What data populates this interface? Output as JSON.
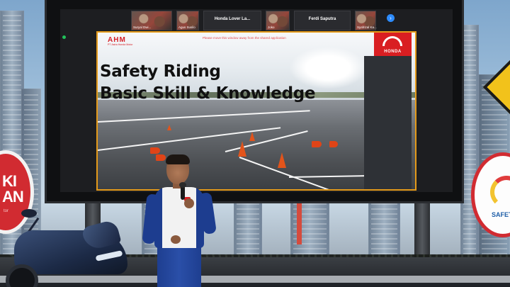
{
  "participants": [
    {
      "name": "Suryal Dwi...",
      "has_video": true
    },
    {
      "name": "Agus Susilo",
      "has_video": true
    },
    {
      "name": "Honda Lover La...",
      "has_video": false
    },
    {
      "name": "Joko",
      "has_video": true
    },
    {
      "name": "Ferdi Saputra",
      "has_video": false
    },
    {
      "name": "Syafrizal Ka...",
      "has_video": true
    }
  ],
  "share_notice": "Please move this window away from the shared application",
  "slide": {
    "title_line1": "Safety Riding",
    "title_line2": "Basic Skill & Knowledge",
    "company_logo": "AHM",
    "company_name": "PT Astra Honda Motor",
    "brand_logo": "HONDA"
  },
  "side_logos": {
    "left_text_line1": "KI",
    "left_text_line2": "AN",
    "left_sub": "tor",
    "right_text": "SAFETY"
  },
  "icons": {
    "next_participants": "chevron-right-icon",
    "connection_status": "status-dot-icon"
  },
  "colors": {
    "slide_border": "#e49a1a",
    "honda_red": "#d91e22",
    "zoom_blue": "#2d8cff",
    "cone_orange": "#e2541b"
  }
}
